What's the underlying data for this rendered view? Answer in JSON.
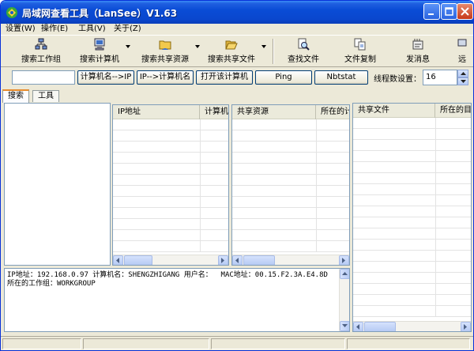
{
  "window": {
    "title": "局域网查看工具（LanSee）V1.63",
    "title_gradient_color": "#0a4cd6",
    "close_color": "#c7381a"
  },
  "menu": [
    {
      "label": "设置(W)"
    },
    {
      "label": "操作(E)"
    },
    {
      "label": "工具(V)"
    },
    {
      "label": "关于(Z)"
    }
  ],
  "toolbar": [
    {
      "label": "搜索工作组",
      "icon": "workgroup-network-icon"
    },
    {
      "label": "搜索计算机",
      "icon": "computer-icon"
    },
    {
      "label": "搜索共享资源",
      "icon": "shared-folder-icon"
    },
    {
      "label": "搜索共享文件",
      "icon": "open-folder-icon"
    },
    {
      "label": "查找文件",
      "icon": "find-file-icon"
    },
    {
      "label": "文件复制",
      "icon": "file-copy-icon"
    },
    {
      "label": "发消息",
      "icon": "send-message-icon"
    },
    {
      "label": "远",
      "icon": "remote-icon"
    }
  ],
  "actions": {
    "ip_value": "",
    "name_to_ip": "计算机名-->IP",
    "ip_to_name": "IP-->计算机名",
    "open_computer": "打开该计算机",
    "ping": "Ping",
    "nbtstat": "Nbtstat",
    "threads_label": "线程数设置：",
    "threads_value": "16"
  },
  "tabs": [
    {
      "label": "搜索",
      "active": true
    },
    {
      "label": "工具",
      "active": false
    }
  ],
  "grids": {
    "computers": {
      "columns": [
        "IP地址",
        "计算机名"
      ]
    },
    "shares": {
      "columns": [
        "共享资源",
        "所在的计"
      ]
    },
    "files": {
      "columns": [
        "共享文件",
        "所在的目"
      ]
    }
  },
  "info": {
    "line1": "IP地址：192.168.0.97 计算机名：SHENGZHIGANG 用户名：  MAC地址：00.15.F2.3A.E4.8D",
    "line2": "所在的工作组：WORKGROUP"
  },
  "status": [
    "",
    "",
    "",
    ""
  ]
}
